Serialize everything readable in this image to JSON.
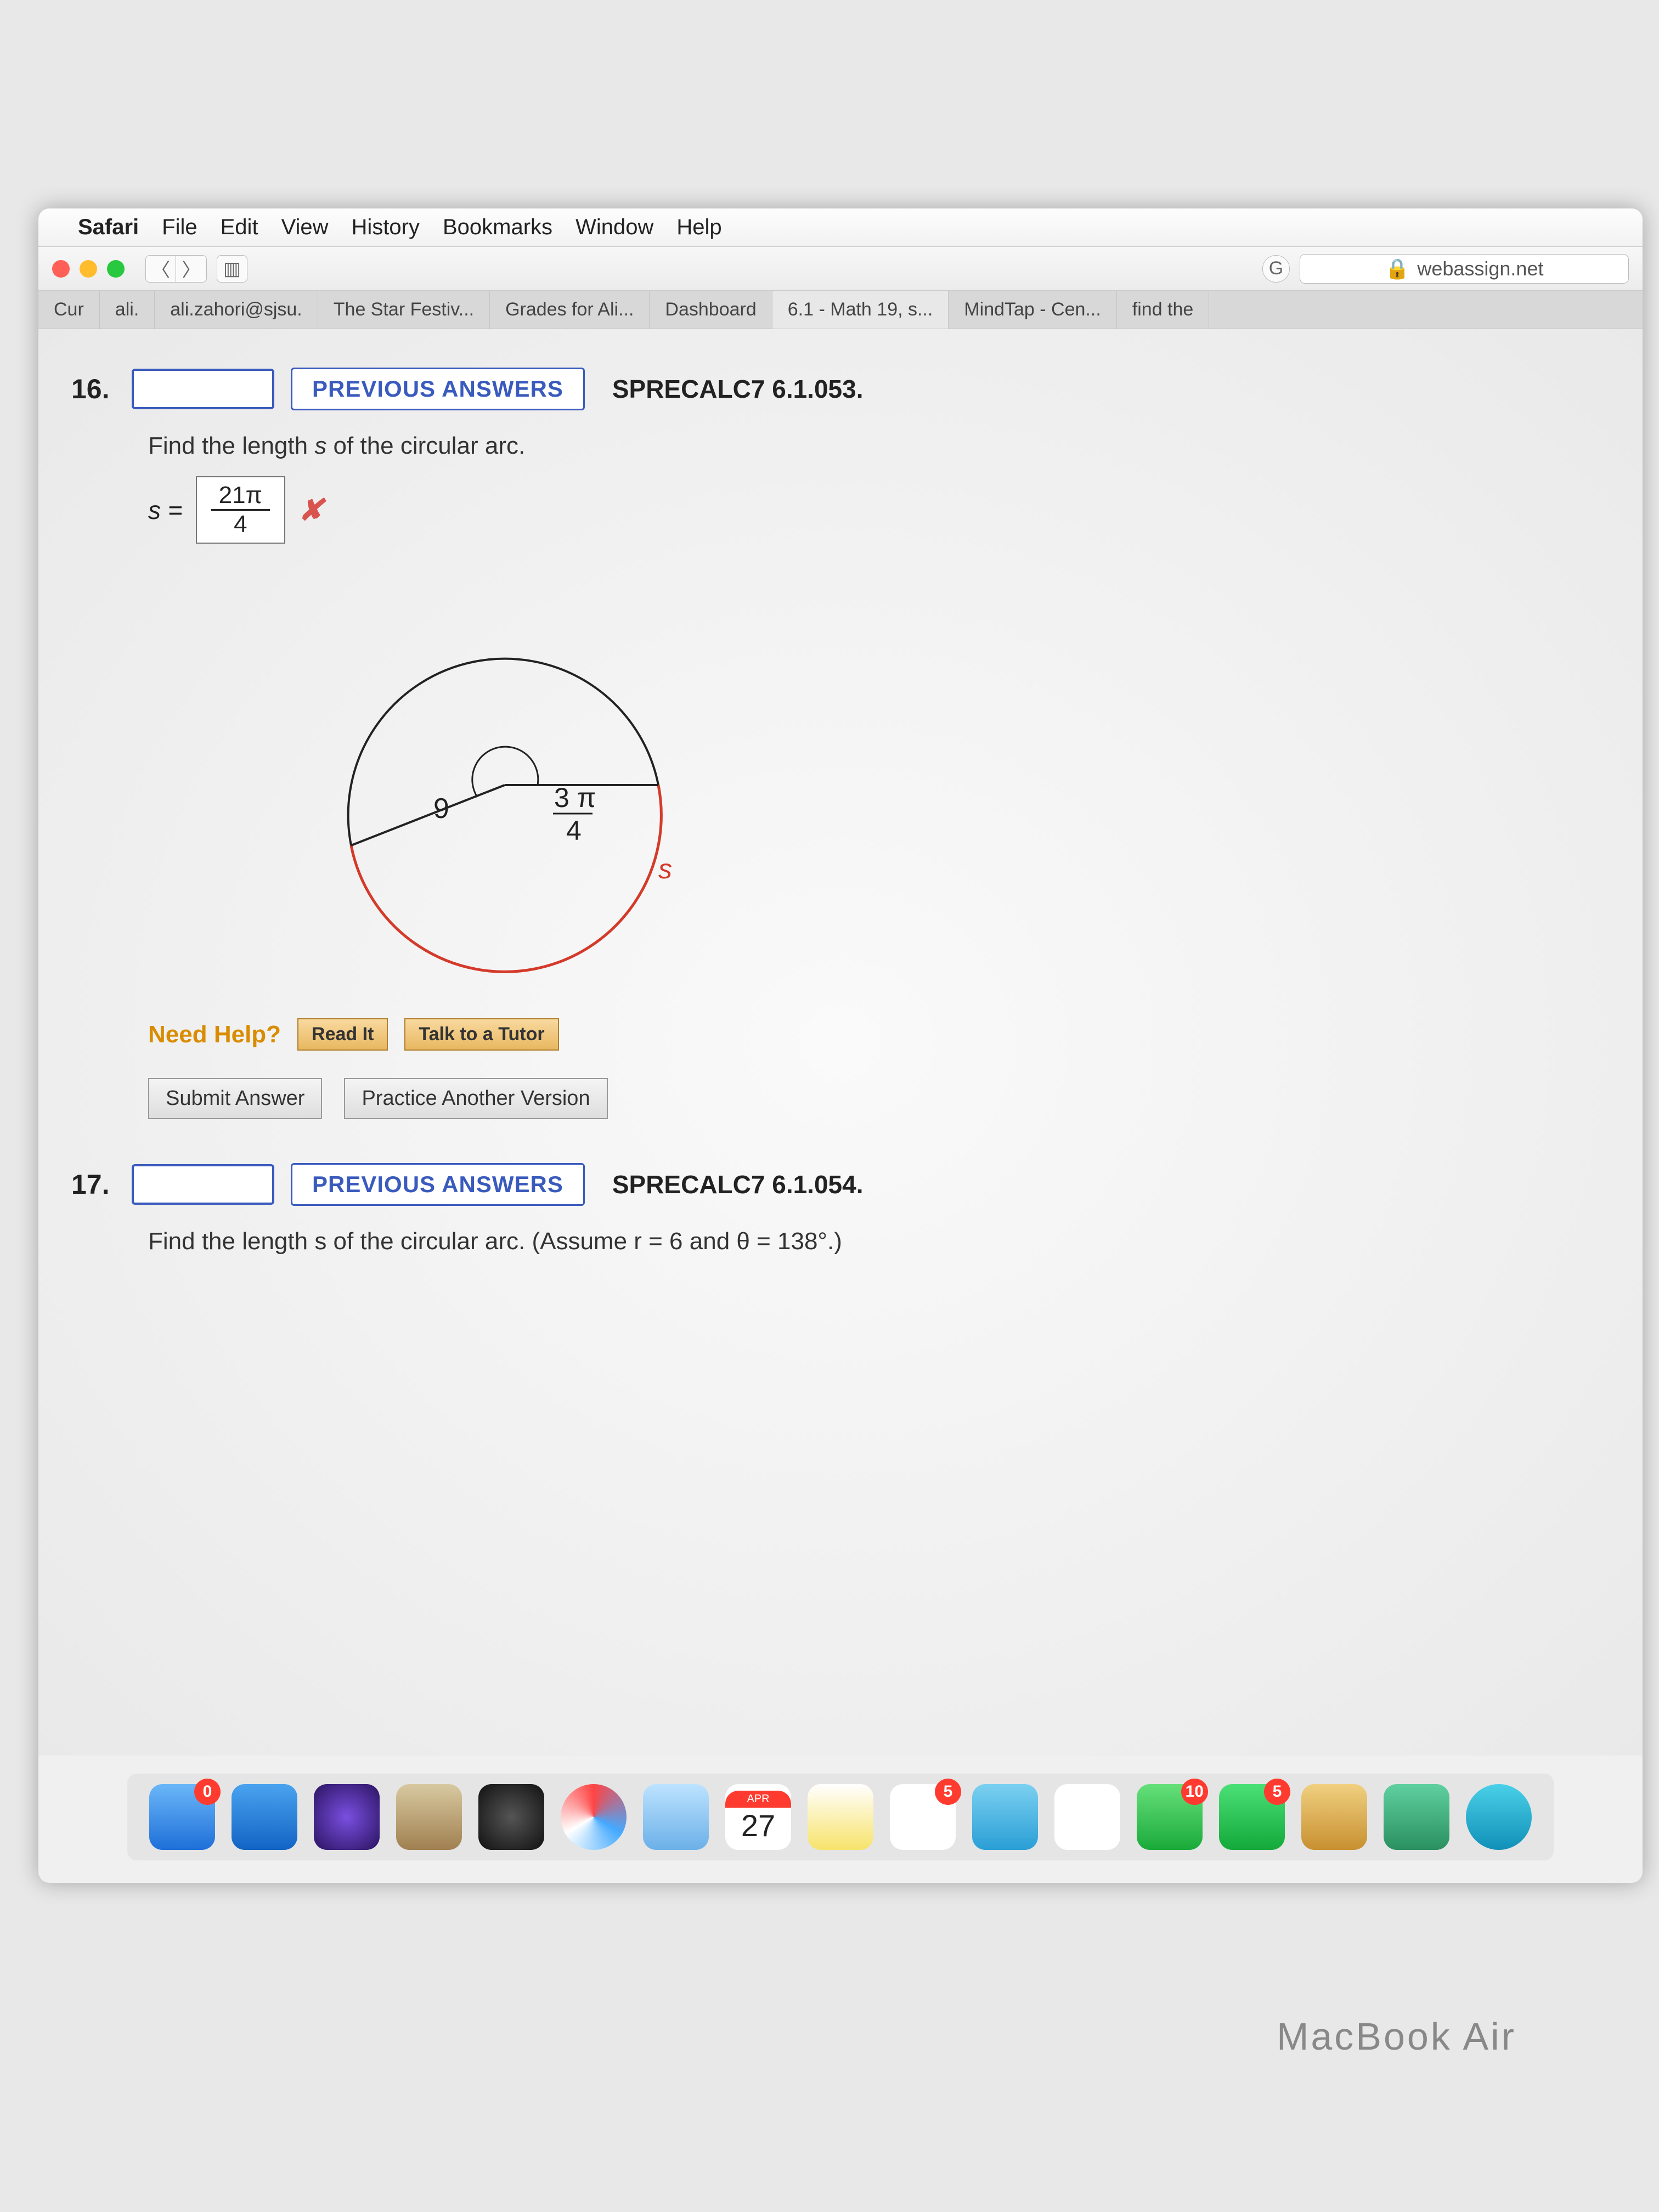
{
  "menubar": {
    "app": "Safari",
    "items": [
      "File",
      "Edit",
      "View",
      "History",
      "Bookmarks",
      "Window",
      "Help"
    ]
  },
  "toolbar": {
    "url_host": "webassign.net",
    "lock": "🔒"
  },
  "tabs": [
    {
      "label": "Cur"
    },
    {
      "label": "ali."
    },
    {
      "label": "ali.zahori@sjsu."
    },
    {
      "label": "The Star Festiv..."
    },
    {
      "label": "Grades for Ali..."
    },
    {
      "label": "Dashboard"
    },
    {
      "label": "6.1 - Math 19, s..."
    },
    {
      "label": "MindTap - Cen..."
    },
    {
      "label": "find the"
    }
  ],
  "q16": {
    "num": "16.",
    "prev_btn": "PREVIOUS ANSWERS",
    "ref": "SPRECALC7 6.1.053.",
    "prompt": "Find the length s of the circular arc.",
    "s_eq": "s =",
    "ans_top": "21π",
    "ans_bot": "4",
    "diagram": {
      "radius_label": "9",
      "angle_top": "3 π",
      "angle_bot": "4",
      "arc_label": "s"
    },
    "help_label": "Need Help?",
    "read_btn": "Read It",
    "tutor_btn": "Talk to a Tutor",
    "submit": "Submit Answer",
    "practice": "Practice Another Version"
  },
  "q17": {
    "num": "17.",
    "prev_btn": "PREVIOUS ANSWERS",
    "ref": "SPRECALC7 6.1.054.",
    "prompt": "Find the length s of the circular arc. (Assume r = 6 and θ = 138°.)"
  },
  "dock": {
    "cal_month": "APR",
    "cal_day": "27",
    "badges": {
      "mail": "0",
      "messages": "10",
      "facetime": "5",
      "reminders": "5"
    }
  },
  "laptop": "MacBook Air",
  "chart_data": {
    "type": "diagram",
    "note": "Circle with radius 9, central angle 3π/4, red arc labeled s (clockwise from radius to horizontal)."
  }
}
